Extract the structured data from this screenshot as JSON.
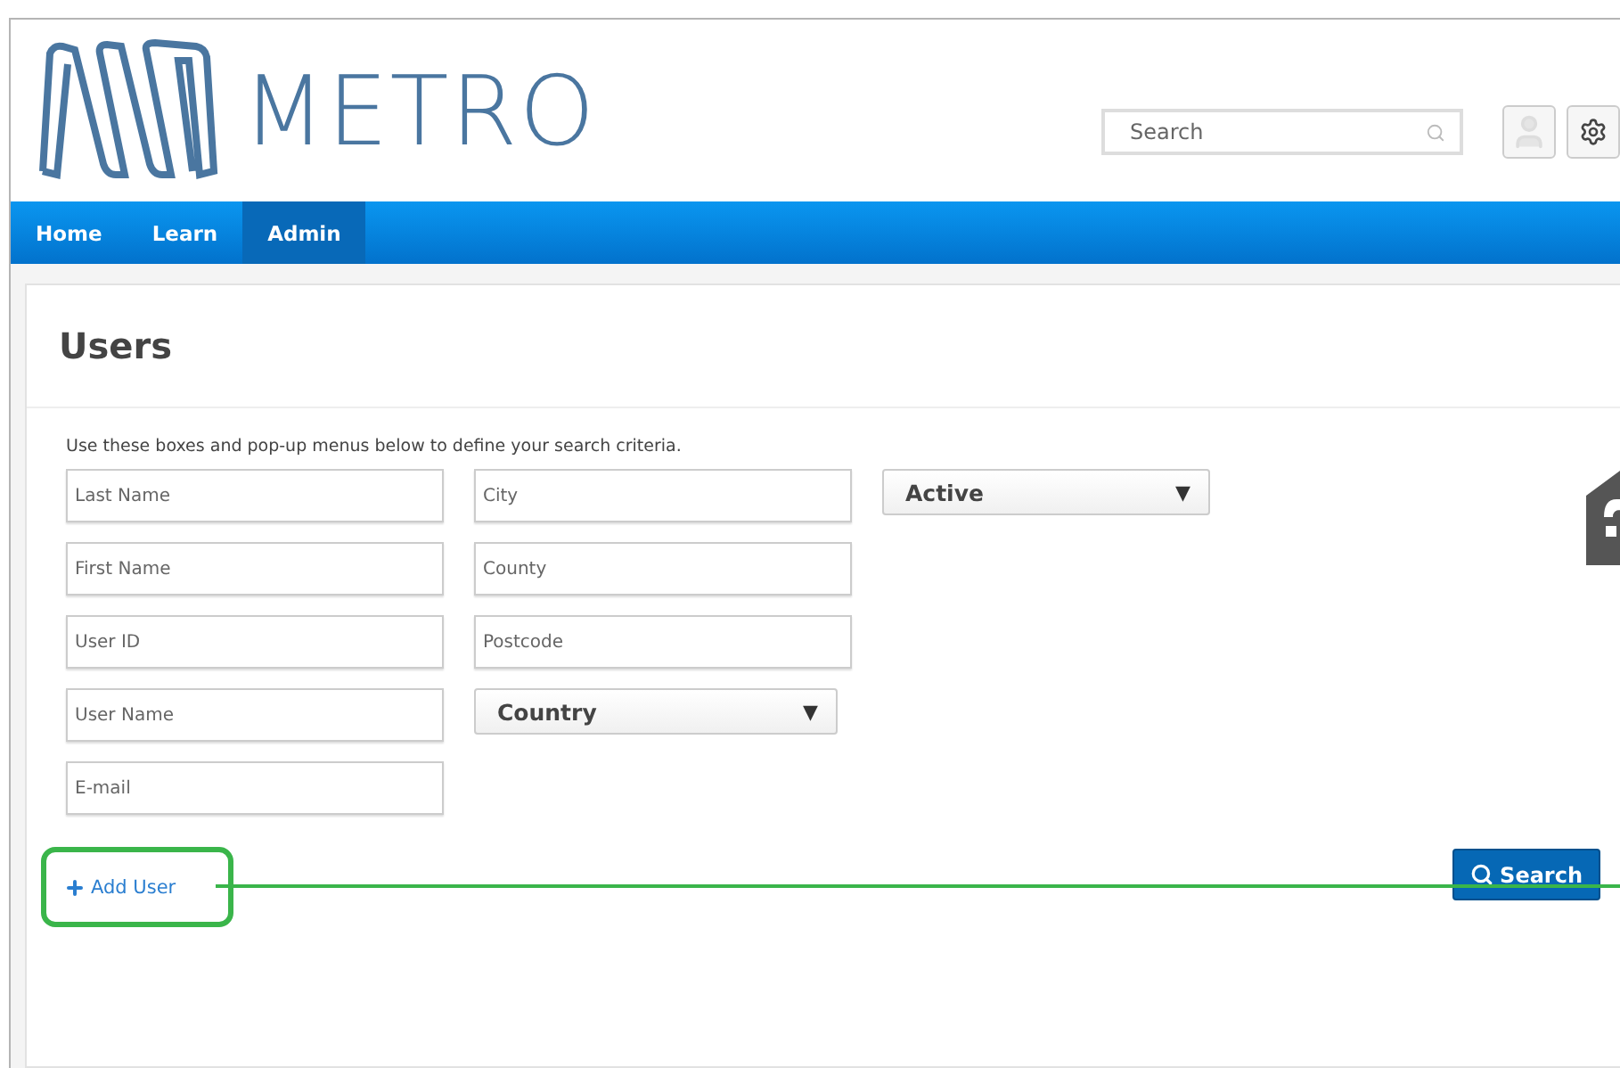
{
  "header": {
    "logo": "METRO",
    "search": {
      "placeholder": "Search"
    }
  },
  "nav": [
    {
      "label": "Home",
      "selected": false
    },
    {
      "label": "Learn",
      "selected": false
    },
    {
      "label": "Admin",
      "selected": true
    }
  ],
  "page": {
    "title": "Users",
    "instructions": "Use these boxes and pop-up menus below to define your search criteria.",
    "column_1": [
      {
        "placeholder": "Last Name"
      },
      {
        "placeholder": "First Name"
      },
      {
        "placeholder": "User ID"
      },
      {
        "placeholder": "User Name"
      },
      {
        "placeholder": "E-mail"
      }
    ],
    "column_2": [
      {
        "kind": "field",
        "placeholder": "City"
      },
      {
        "kind": "field",
        "placeholder": "County"
      },
      {
        "kind": "field",
        "placeholder": "Postcode"
      },
      {
        "kind": "select",
        "value": "Country",
        "caret": "▼"
      }
    ],
    "status_select": {
      "value": "Active",
      "caret": "▼"
    },
    "add_user": "Add User",
    "search_button": "Search"
  }
}
